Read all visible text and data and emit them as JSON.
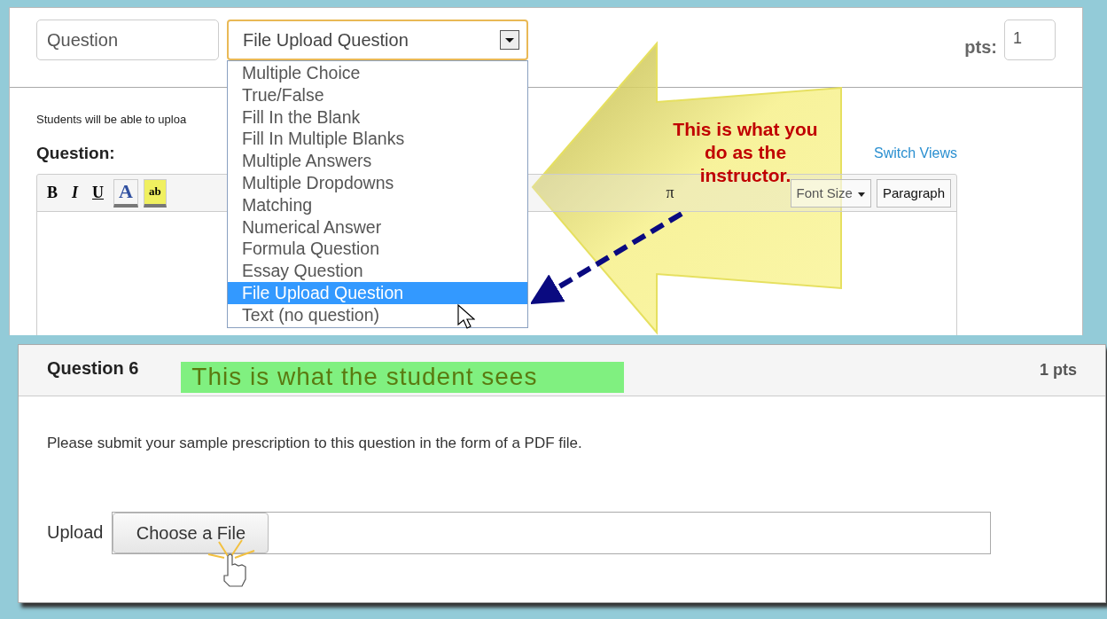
{
  "question_editor": {
    "name_field": {
      "value": "Question"
    },
    "type_select": {
      "value": "File Upload Question",
      "expanded": true,
      "options": [
        {
          "label": "Multiple Choice",
          "selected": false
        },
        {
          "label": "True/False",
          "selected": false
        },
        {
          "label": "Fill In the Blank",
          "selected": false
        },
        {
          "label": "Fill In Multiple Blanks",
          "selected": false
        },
        {
          "label": "Multiple Answers",
          "selected": false
        },
        {
          "label": "Multiple Dropdowns",
          "selected": false
        },
        {
          "label": "Matching",
          "selected": false
        },
        {
          "label": "Numerical Answer",
          "selected": false
        },
        {
          "label": "Formula Question",
          "selected": false
        },
        {
          "label": "Essay Question",
          "selected": false
        },
        {
          "label": "File Upload Question",
          "selected": true
        },
        {
          "label": "Text (no question)",
          "selected": false
        }
      ]
    },
    "points": {
      "label": "pts:",
      "value": "1"
    },
    "hint": "Students will be able to uploa",
    "question_label": "Question:",
    "switch_views": "Switch Views",
    "toolbar": {
      "buttons": [
        {
          "kind": "bold",
          "label": "B"
        },
        {
          "kind": "italic",
          "label": "I"
        },
        {
          "kind": "underline",
          "label": "U"
        },
        {
          "kind": "text-color",
          "label": "A"
        },
        {
          "kind": "highlight",
          "label": "ab"
        }
      ],
      "symbol": "π",
      "font_size": "Font Size",
      "paragraph": "Paragraph"
    }
  },
  "instructor_callout": "This is what you\ndo as the\ninstructor.",
  "student_view": {
    "title": "Question 6",
    "callout": "This is what the student sees",
    "points": "1 pts",
    "prompt": "Please submit your sample prescription to this question in the form of a PDF file.",
    "upload_label": "Upload",
    "choose_button": "Choose a File"
  }
}
